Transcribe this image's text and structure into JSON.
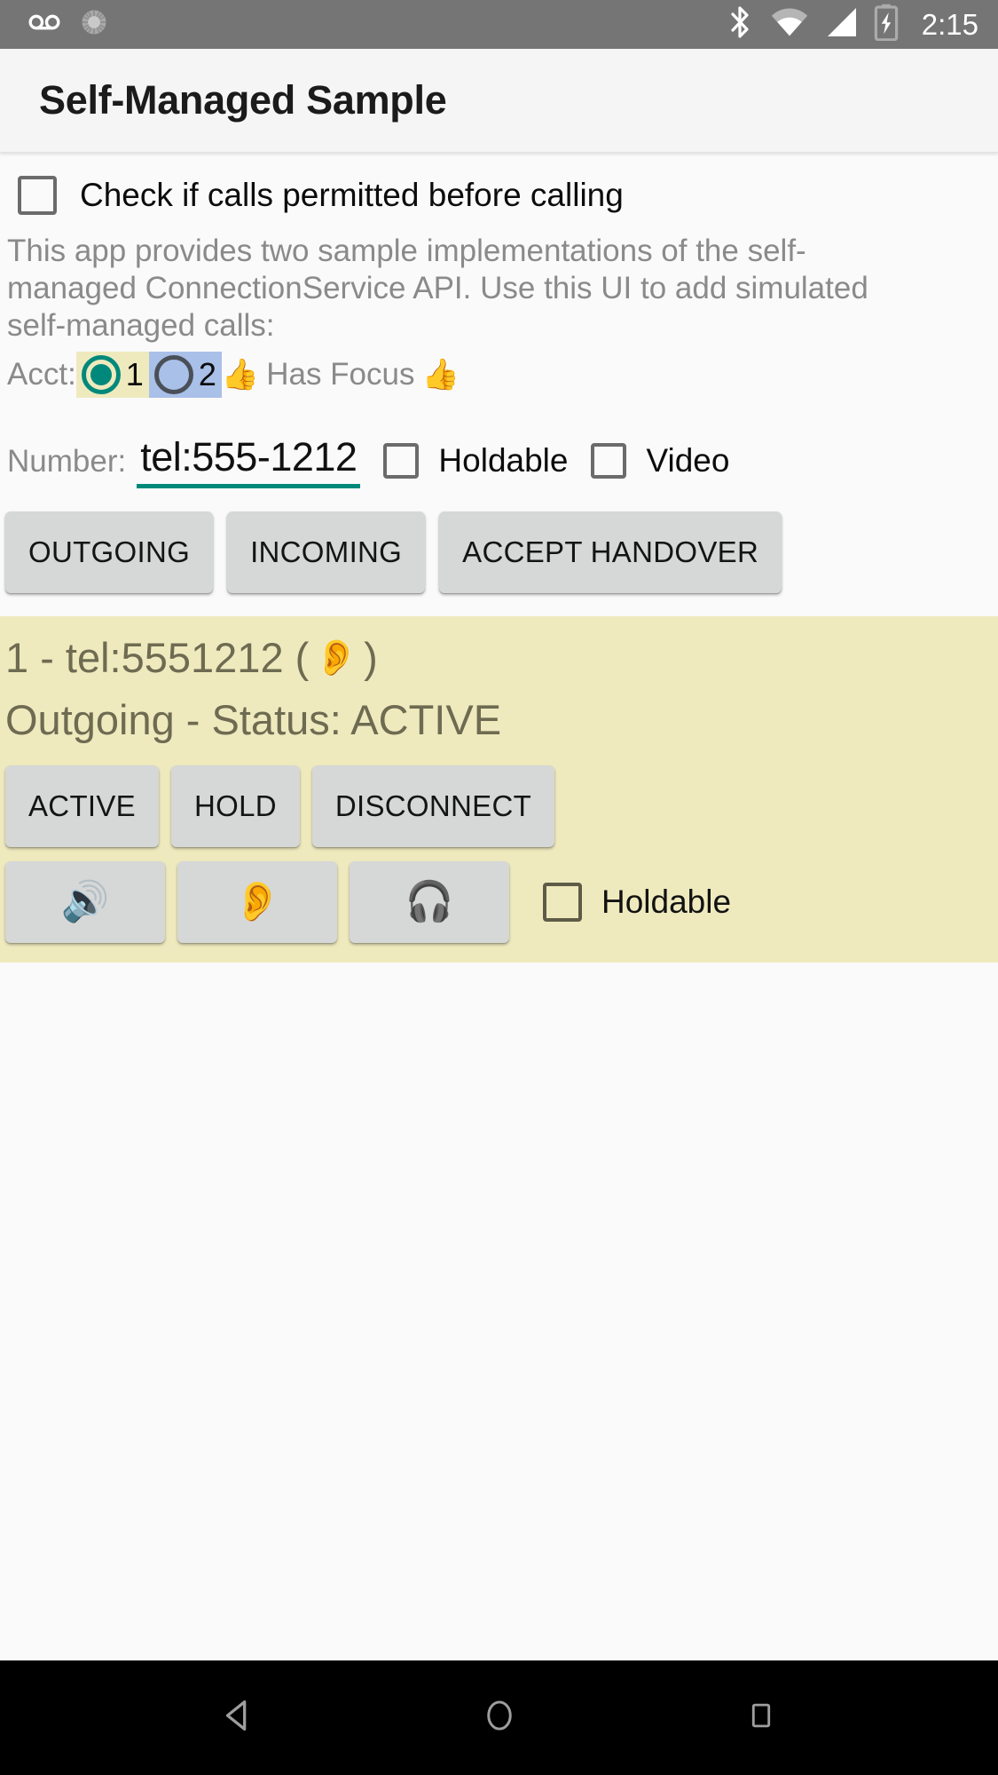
{
  "status_bar": {
    "icons": [
      "voicemail-icon",
      "sync-icon",
      "bluetooth-icon",
      "wifi-icon",
      "cell-signal-icon",
      "battery-charging-icon"
    ],
    "clock": "2:15",
    "background": "#757575"
  },
  "app_bar": {
    "title": "Self-Managed Sample",
    "background": "#f5f5f5"
  },
  "options": {
    "check_permitted_label": "Check if calls permitted before calling",
    "check_permitted_checked": false
  },
  "description": "This app provides two sample implementations of the self-managed ConnectionService API.  Use this UI to add simulated self-managed calls:",
  "account": {
    "label": "Acct:",
    "options": [
      {
        "value": "1",
        "selected": true,
        "highlight": "#efeabe"
      },
      {
        "value": "2",
        "selected": false,
        "highlight": "#a9c0e8"
      }
    ],
    "focus_emoji_left": "👍",
    "focus_text": "Has Focus",
    "focus_emoji_right": "👍",
    "selected_color": "#00897b"
  },
  "number_row": {
    "label": "Number:",
    "value": "tel:555-1212",
    "placeholder": "tel:555-1212",
    "underline_color": "#00897b",
    "holdable_label": "Holdable",
    "holdable_checked": false,
    "video_label": "Video",
    "video_checked": false
  },
  "action_buttons": [
    {
      "label": "OUTGOING",
      "name": "outgoing-button"
    },
    {
      "label": "INCOMING",
      "name": "incoming-button"
    },
    {
      "label": "ACCEPT HANDOVER",
      "name": "accept-handover-button"
    }
  ],
  "call_card": {
    "background": "#efeabe",
    "text_color": "#6e6b52",
    "line1_prefix": "1 - tel:5551212 (",
    "line1_emoji": "👂",
    "line1_suffix": ")",
    "line2": "Outgoing - Status: ACTIVE",
    "state_buttons": [
      {
        "label": "ACTIVE",
        "name": "call-active-button"
      },
      {
        "label": "HOLD",
        "name": "call-hold-button"
      },
      {
        "label": "DISCONNECT",
        "name": "call-disconnect-button"
      }
    ],
    "audio_buttons": [
      {
        "emoji": "🔊",
        "name": "audio-route-speaker-button"
      },
      {
        "emoji": "👂",
        "name": "audio-route-earpiece-button"
      },
      {
        "emoji": "🎧",
        "name": "audio-route-headset-button"
      }
    ],
    "holdable_label": "Holdable",
    "holdable_checked": false
  },
  "nav_bar": {
    "back": "back-nav-icon",
    "home": "home-nav-icon",
    "recents": "recents-nav-icon",
    "background": "#000000"
  }
}
